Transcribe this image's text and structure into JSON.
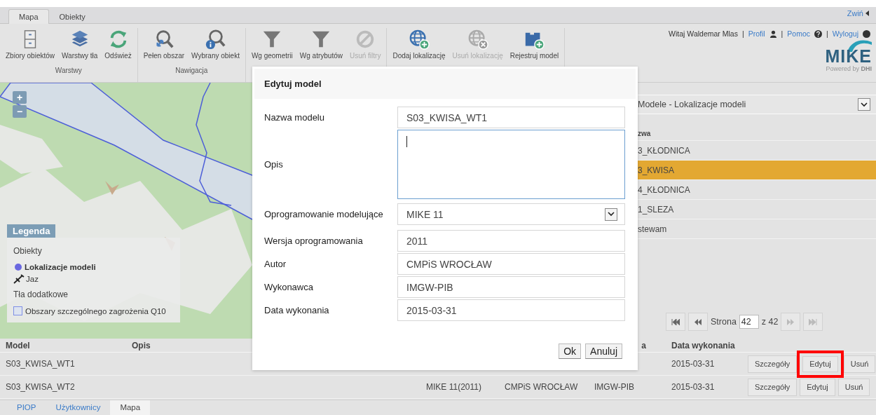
{
  "top_tabs": [
    {
      "label": "Mapa",
      "selected": true
    },
    {
      "label": "Obiekty",
      "selected": false
    }
  ],
  "collapse_link": "Zwiń",
  "ribbon_groups": [
    {
      "label": "Warstwy",
      "buttons": [
        {
          "label": "Zbiory obiektów",
          "disabled": false
        },
        {
          "label": "Warstwy tła",
          "disabled": false
        },
        {
          "label": "Odśwież",
          "disabled": false
        }
      ]
    },
    {
      "label": "Nawigacja",
      "buttons": [
        {
          "label": "Pełen obszar",
          "disabled": false
        },
        {
          "label": "Wybrany obiekt",
          "disabled": false
        }
      ]
    },
    {
      "buttons": [
        {
          "label": "Wg geometrii",
          "disabled": false
        },
        {
          "label": "Wg atrybutów",
          "disabled": false
        },
        {
          "label": "Usuń filtry",
          "disabled": true
        }
      ]
    },
    {
      "buttons": [
        {
          "label": "Dodaj lokalizację",
          "disabled": false
        },
        {
          "label": "Usuń lokalizację",
          "disabled": true
        },
        {
          "label": "Rejestruj model",
          "disabled": false
        }
      ]
    }
  ],
  "user_bar": {
    "greeting": "Witaj Waldemar Mlas",
    "separator": "|",
    "links": [
      "Profil",
      "Pomoc",
      "Wyloguj"
    ]
  },
  "logo": {
    "name": "MIKE",
    "tagline": "Powered by",
    "brand": "DHI"
  },
  "map": {
    "zoom_in": "+",
    "zoom_out": "−"
  },
  "legend": {
    "title": "Legenda",
    "sections": [
      {
        "heading": "Obiekty",
        "items": [
          {
            "label": "Lokalizacje modeli",
            "kind": "dot"
          },
          {
            "label": "Jaz",
            "kind": "weir"
          }
        ]
      },
      {
        "heading": "Tła dodatkowe",
        "items": [
          {
            "label": "Obszary szczególnego zagrożenia Q10",
            "kind": "area"
          }
        ]
      }
    ]
  },
  "layer_panel": {
    "title": "Modele - Lokalizacje modeli",
    "column": "zwa",
    "rows": [
      {
        "name": "3_KŁODNICA",
        "selected": false
      },
      {
        "name": "3_KWISA",
        "selected": true
      },
      {
        "name": "4_KŁODNICA",
        "selected": false
      },
      {
        "name": "1_SLEZA",
        "selected": false
      },
      {
        "name": "stewam",
        "selected": false
      }
    ],
    "pager": {
      "label": "Strona",
      "page": "42",
      "total": "z 42"
    }
  },
  "table": {
    "header": {
      "model": "Model",
      "opis": "Opis",
      "column_5": "a",
      "date": "Data wykonania"
    },
    "rows": [
      {
        "model": "S03_KWISA_WT1",
        "date": "2015-03-31",
        "actions": [
          {
            "label": "Szczegóły",
            "highlighted": false
          },
          {
            "label": "Edytuj",
            "highlighted": true
          },
          {
            "label": "Usuń",
            "highlighted": false
          }
        ]
      },
      {
        "model": "S03_KWISA_WT2",
        "software": "MIKE 11(2011)",
        "author": "CMPiS WROCŁAW",
        "column_5": "IMGW-PIB",
        "date": "2015-03-31",
        "actions": [
          {
            "label": "Szczegóły",
            "highlighted": false
          },
          {
            "label": "Edytuj",
            "highlighted": false
          },
          {
            "label": "Usuń",
            "highlighted": false
          }
        ]
      }
    ]
  },
  "footer_tabs": [
    {
      "label": "PIOP",
      "selected": false
    },
    {
      "label": "Użytkownicy",
      "selected": false
    },
    {
      "label": "Mapa",
      "selected": true
    }
  ],
  "dialog": {
    "title": "Edytuj model",
    "fields": [
      {
        "label": "Nazwa modelu",
        "kind": "text",
        "value": "S03_KWISA_WT1"
      },
      {
        "label": "Opis",
        "kind": "textarea",
        "focused": true
      },
      {
        "label": "Oprogramowanie modelujące",
        "kind": "select",
        "value": "MIKE 11"
      },
      {
        "label": "Wersja oprogramowania",
        "kind": "text",
        "value": "2011"
      },
      {
        "label": "Autor",
        "kind": "text",
        "value": "CMPiS WROCŁAW"
      },
      {
        "label": "Wykonawca",
        "kind": "text",
        "value": "IMGW-PIB"
      },
      {
        "label": "Data wykonania",
        "kind": "text",
        "value": "2015-03-31"
      }
    ],
    "buttons": [
      "Ok",
      "Anuluj"
    ]
  }
}
